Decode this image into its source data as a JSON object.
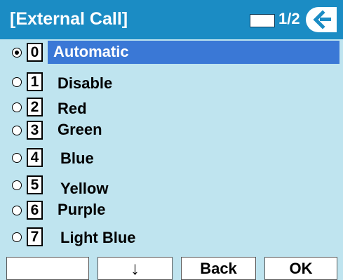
{
  "header": {
    "title": "[External Call]",
    "page_indicator": "1/2",
    "back_icon": "back-arrow-icon"
  },
  "options": [
    {
      "key": "0",
      "label": "Automatic",
      "selected": true
    },
    {
      "key": "1",
      "label": "Disable",
      "selected": false
    },
    {
      "key": "2",
      "label": "Red",
      "selected": false
    },
    {
      "key": "3",
      "label": "Green",
      "selected": false
    },
    {
      "key": "4",
      "label": "Blue",
      "selected": false
    },
    {
      "key": "5",
      "label": "Yellow",
      "selected": false
    },
    {
      "key": "6",
      "label": "Purple",
      "selected": false
    },
    {
      "key": "7",
      "label": "Light Blue",
      "selected": false
    }
  ],
  "softkeys": {
    "key1": "",
    "key2": "↓",
    "key3": "Back",
    "key4": "OK"
  },
  "colors": {
    "header_bg": "#1b8cc4",
    "screen_bg": "#bfe4ef",
    "highlight": "#3a78d6"
  }
}
